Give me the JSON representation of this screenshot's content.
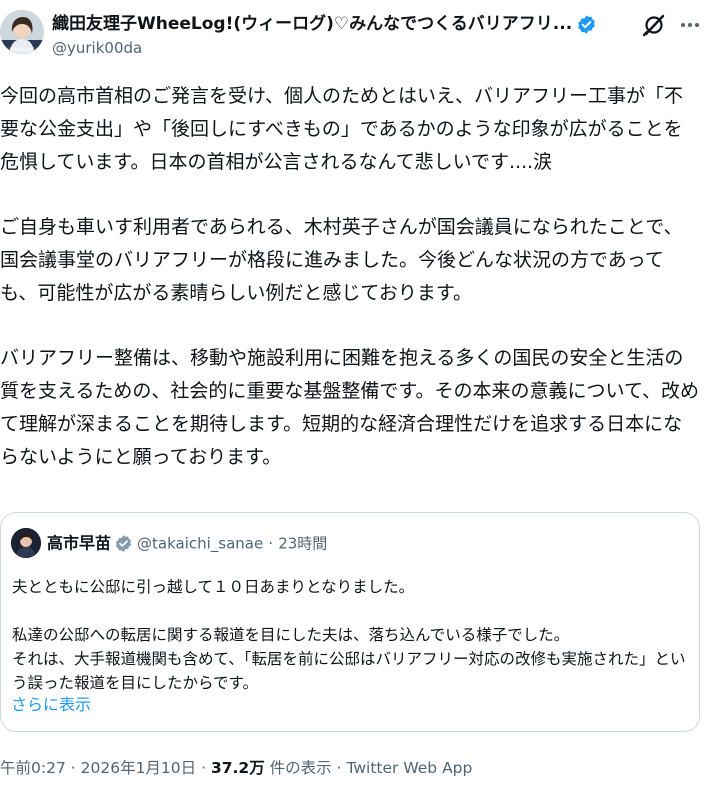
{
  "author": {
    "display_name": "織田友理子WheeLog!(ウィーログ)♡みんなでつくるバリアフリ...",
    "handle": "@yurik00da",
    "avatar_alt": "avatar"
  },
  "icons": {
    "verified": "verified-badge-icon",
    "grok": "grok-icon",
    "more": "more-options-icon"
  },
  "post": {
    "paragraphs": [
      "今回の高市首相のご発言を受け、個人のためとはいえ、バリアフリー工事が「不要な公金支出」や「後回しにすべきもの」であるかのような印象が広がることを危惧しています。日本の首相が公言されるなんて悲しいです....涙",
      "ご自身も車いす利用者であられる、木村英子さんが国会議員になられたことで、国会議事堂のバリアフリーが格段に進みました。今後どんな状況の方であっても、可能性が広がる素晴らしい例だと感じております。",
      "バリアフリー整備は、移動や施設利用に困難を抱える多くの国民の安全と生活の質を支えるための、社会的に重要な基盤整備です。その本来の意義について、改めて理解が深まることを期待します。短期的な経済合理性だけを追求する日本にならないようにと願っております。"
    ]
  },
  "quote": {
    "display_name": "高市早苗",
    "handle": "@takaichi_sanae",
    "separator": "·",
    "time": "23時間",
    "paragraphs": [
      "夫とともに公邸に引っ越して１０日あまりとなりました。",
      "私達の公邸への転居に関する報道を目にした夫は、落ち込んでいる様子でした。\nそれは、大手報道機関も含めて、「転居を前に公邸はバリアフリー対応の改修も実施された」という誤った報道を目にしたからです。"
    ],
    "show_more": "さらに表示"
  },
  "meta": {
    "time": "午前0:27",
    "separator": "·",
    "date": "2026年1月10日",
    "separator2": "·",
    "views_count": "37.2万",
    "views_label": " 件の表示",
    "separator3": "·",
    "source": "Twitter Web App"
  },
  "colors": {
    "text": "#0f1419",
    "secondary": "#536471",
    "link": "#1d9bf0",
    "border": "#cfd9de"
  }
}
